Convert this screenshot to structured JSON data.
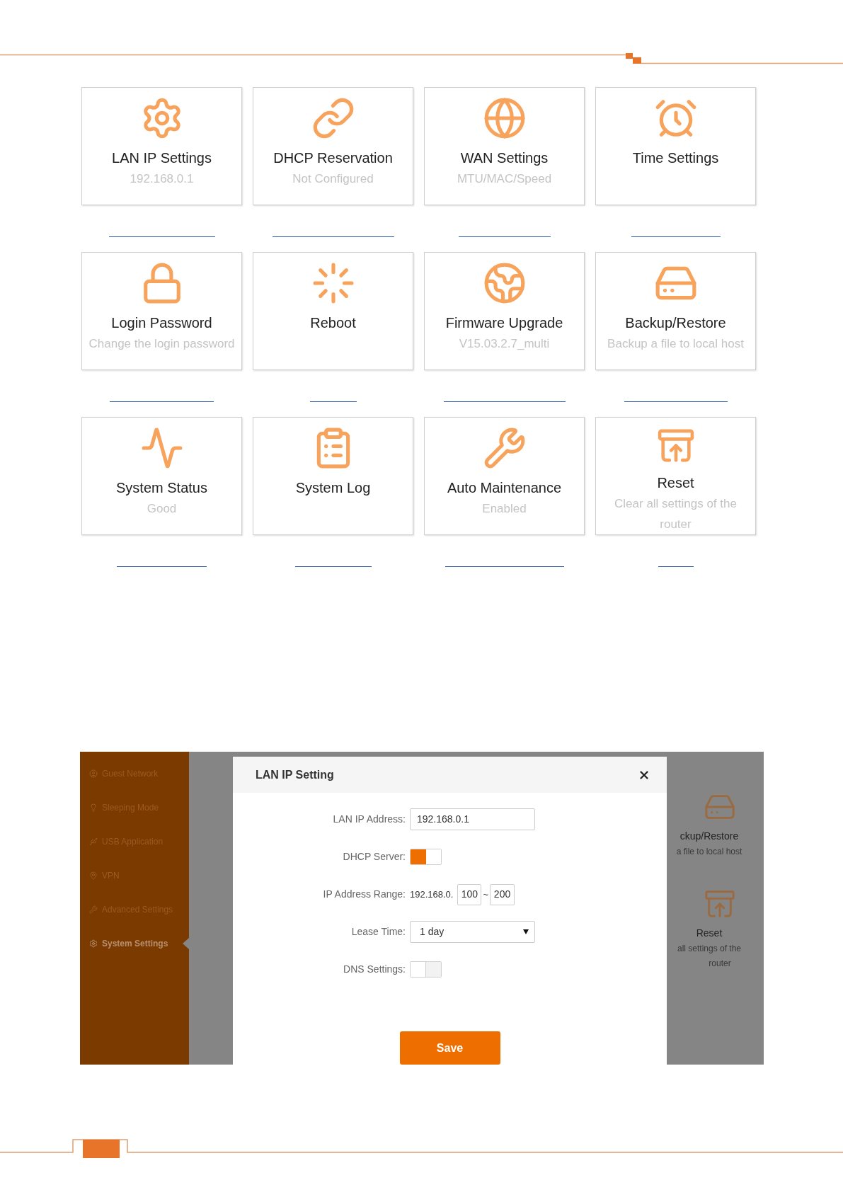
{
  "tiles": [
    {
      "title": "LAN IP Settings",
      "subtitle": "192.168.0.1"
    },
    {
      "title": "DHCP Reservation",
      "subtitle": "Not Configured"
    },
    {
      "title": "WAN Settings",
      "subtitle": "MTU/MAC/Speed"
    },
    {
      "title": "Time Settings"
    },
    {
      "title": "Login Password",
      "subtitle": "Change the login password"
    },
    {
      "title": "Reboot"
    },
    {
      "title": "Firmware Upgrade",
      "subtitle": "V15.03.2.7_multi"
    },
    {
      "title": "Backup/Restore",
      "subtitle": "Backup a file to local host"
    },
    {
      "title": "System Status",
      "subtitle": "Good"
    },
    {
      "title": "System Log"
    },
    {
      "title": "Auto Maintenance",
      "subtitle": "Enabled"
    },
    {
      "title": "Reset",
      "subtitle": "Clear all settings of the router"
    }
  ],
  "router_ui": {
    "sidebar": {
      "items": [
        {
          "label": "Guest Network",
          "selected": false
        },
        {
          "label": "Sleeping Mode",
          "selected": false
        },
        {
          "label": "USB Application",
          "selected": false
        },
        {
          "label": "VPN",
          "selected": false
        },
        {
          "label": "Advanced Settings",
          "selected": false
        },
        {
          "label": "System Settings",
          "selected": true
        }
      ]
    },
    "dialog": {
      "title": "LAN IP Setting",
      "fields": [
        {
          "kind": "text",
          "label": "LAN IP Address:",
          "value": "192.168.0.1"
        },
        {
          "kind": "toggle",
          "label": "DHCP Server:",
          "on": true
        },
        {
          "kind": "range",
          "label": "IP Address Range:",
          "prefix": "192.168.0.",
          "start": "100",
          "separator": "~",
          "end": "200"
        },
        {
          "kind": "select",
          "label": "Lease Time:",
          "value": "1 day"
        },
        {
          "kind": "toggle",
          "label": "DNS Settings:",
          "on": false
        }
      ],
      "save_button": "Save"
    },
    "background_tiles": [
      {
        "title": "ckup/Restore",
        "subtitle": "a file to local host"
      },
      {
        "title": "Reset",
        "subtitle": "all settings of the",
        "subtitle_2": "router"
      }
    ]
  }
}
